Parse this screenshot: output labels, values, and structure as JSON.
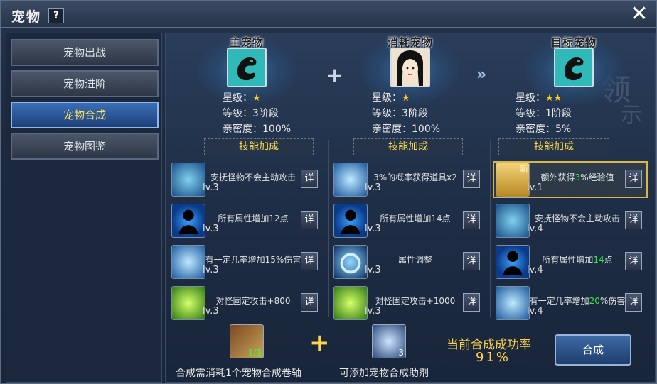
{
  "window": {
    "title": "宠物",
    "help_label": "?",
    "close_label": "✕"
  },
  "sidebar": {
    "items": [
      {
        "label": "宠物出战",
        "active": false
      },
      {
        "label": "宠物进阶",
        "active": false
      },
      {
        "label": "宠物合成",
        "active": true
      },
      {
        "label": "宠物图鉴",
        "active": false
      }
    ]
  },
  "columns": [
    {
      "title": "主宠物",
      "star_label": "星级：",
      "stars": 1,
      "stars_text": "★",
      "level_label": "等级：",
      "level": "3阶段",
      "intimacy_label": "亲密度：",
      "intimacy": "100%",
      "skill_header": "技能加成",
      "skills": [
        {
          "name": "安抚怪物不会主动攻击",
          "lv": "lv.3",
          "icon": "shell-icon"
        },
        {
          "name": "所有属性增加12点",
          "lv": "lv.3",
          "icon": "silhouette-icon"
        },
        {
          "name": "有一定几率增加15%伤害",
          "lv": "lv.3",
          "icon": "blade-icon"
        },
        {
          "name": "对怪固定攻击+800",
          "lv": "lv.3",
          "icon": "chain-icon"
        }
      ]
    },
    {
      "title": "消耗宠物",
      "star_label": "星级：",
      "stars": 1,
      "stars_text": "★",
      "level_label": "等级：",
      "level": "3阶段",
      "intimacy_label": "亲密度：",
      "intimacy": "100%",
      "skill_header": "技能加成",
      "skills": [
        {
          "name": "3%的概率获得道具x2",
          "lv": "lv.3",
          "icon": "gems-icon"
        },
        {
          "name": "所有属性增加14点",
          "lv": "lv.3",
          "icon": "silhouette-icon"
        },
        {
          "name": "属性调整",
          "lv": "lv.3",
          "icon": "ring-icon"
        },
        {
          "name": "对怪固定攻击+1000",
          "lv": "lv.3",
          "icon": "chain-icon"
        }
      ]
    },
    {
      "title": "目标宠物",
      "star_label": "星级：",
      "stars": 2,
      "stars_text": "★★",
      "level_label": "等级：",
      "level": "1阶段",
      "intimacy_label": "亲密度：",
      "intimacy": "5%",
      "skill_header": "技能加成",
      "skills": [
        {
          "name_pre": "额外获得",
          "name_hl": "3",
          "name_post": "%经验值",
          "lv": "lv.1",
          "icon": "exp-icon",
          "new_label": "新"
        },
        {
          "name": "安抚怪物不会主动攻击",
          "lv": "lv.4",
          "icon": "shell-icon"
        },
        {
          "name_pre": "所有属性增加",
          "name_hl": "14",
          "name_post": "点",
          "lv": "lv.4",
          "icon": "silhouette-icon"
        },
        {
          "name_pre": "有一定几率增加",
          "name_hl": "20",
          "name_post": "%伤害",
          "lv": "lv.4",
          "icon": "blade-icon"
        }
      ]
    }
  ],
  "detail_label": "详",
  "bottom": {
    "scroll_count": "1/1",
    "scroll_caption": "合成需消耗1个宠物合成卷轴",
    "catalyst_count": "3",
    "catalyst_caption": "可添加宠物合成助剂",
    "rate_label": "当前合成成功率",
    "rate_value": "91%",
    "compose_label": "合成"
  },
  "colors": {
    "accent": "#ffd24a",
    "active_tab": "#1d3f78",
    "highlight": "#34e34a"
  }
}
